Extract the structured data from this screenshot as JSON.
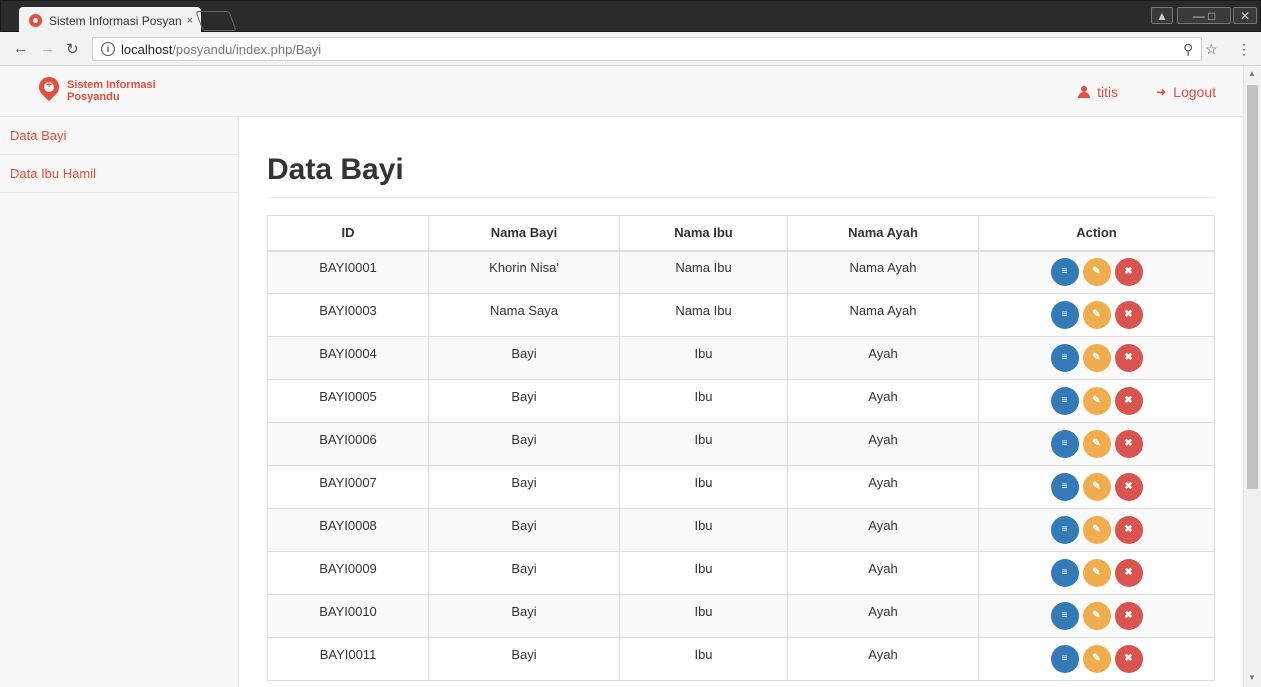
{
  "browser": {
    "tab_title": "Sistem Informasi Posyan",
    "tab_close": "×",
    "url_host": "localhost",
    "url_path": "/posyandu/index.php/Bayi"
  },
  "navbar": {
    "brand": "Sistem Informasi Posyandu",
    "user": "titis",
    "logout": "Logout"
  },
  "sidebar": {
    "items": [
      {
        "label": "Data Bayi"
      },
      {
        "label": "Data Ibu Hamil"
      }
    ]
  },
  "main": {
    "title": "Data Bayi",
    "table": {
      "headers": [
        "ID",
        "Nama Bayi",
        "Nama Ibu",
        "Nama Ayah",
        "Action"
      ],
      "rows": [
        {
          "id": "BAYI0001",
          "nama_bayi": "Khorin Nisa'",
          "nama_ibu": "Nama Ibu",
          "nama_ayah": "Nama Ayah"
        },
        {
          "id": "BAYI0003",
          "nama_bayi": "Nama Saya",
          "nama_ibu": "Nama Ibu",
          "nama_ayah": "Nama Ayah"
        },
        {
          "id": "BAYI0004",
          "nama_bayi": "Bayi",
          "nama_ibu": "Ibu",
          "nama_ayah": "Ayah"
        },
        {
          "id": "BAYI0005",
          "nama_bayi": "Bayi",
          "nama_ibu": "Ibu",
          "nama_ayah": "Ayah"
        },
        {
          "id": "BAYI0006",
          "nama_bayi": "Bayi",
          "nama_ibu": "Ibu",
          "nama_ayah": "Ayah"
        },
        {
          "id": "BAYI0007",
          "nama_bayi": "Bayi",
          "nama_ibu": "Ibu",
          "nama_ayah": "Ayah"
        },
        {
          "id": "BAYI0008",
          "nama_bayi": "Bayi",
          "nama_ibu": "Ibu",
          "nama_ayah": "Ayah"
        },
        {
          "id": "BAYI0009",
          "nama_bayi": "Bayi",
          "nama_ibu": "Ibu",
          "nama_ayah": "Ayah"
        },
        {
          "id": "BAYI0010",
          "nama_bayi": "Bayi",
          "nama_ibu": "Ibu",
          "nama_ayah": "Ayah"
        },
        {
          "id": "BAYI0011",
          "nama_bayi": "Bayi",
          "nama_ibu": "Ibu",
          "nama_ayah": "Ayah"
        }
      ]
    },
    "action_icons": [
      "list-icon",
      "pencil-icon",
      "times-icon"
    ]
  },
  "colors": {
    "accent": "#e74c3c",
    "detail": "#337ab7",
    "edit": "#f0ad4e",
    "delete": "#d9534f"
  }
}
